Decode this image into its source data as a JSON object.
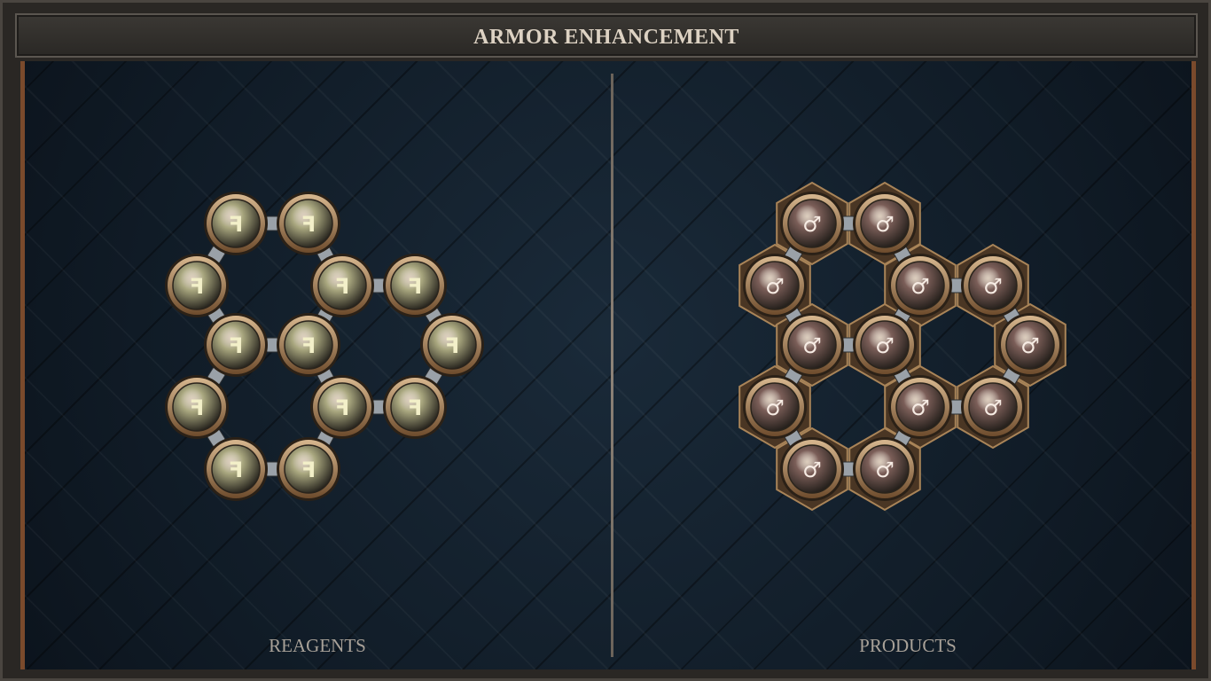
{
  "title": "ARMOR ENHANCEMENT",
  "reagents": {
    "label": "REAGENTS",
    "atom_symbol": "ꟻ",
    "atom_color": "#a9a77f",
    "glyph_color": "#f3f0c9"
  },
  "products": {
    "label": "PRODUCTS",
    "atom_symbol": "♂",
    "atom_color": "#7b5e58",
    "glyph_color": "#f7ece4"
  },
  "colors": {
    "frame": "#2a2724",
    "board": "#12202c",
    "rim": "#b48a5e",
    "bond": "#c8cdd2"
  }
}
